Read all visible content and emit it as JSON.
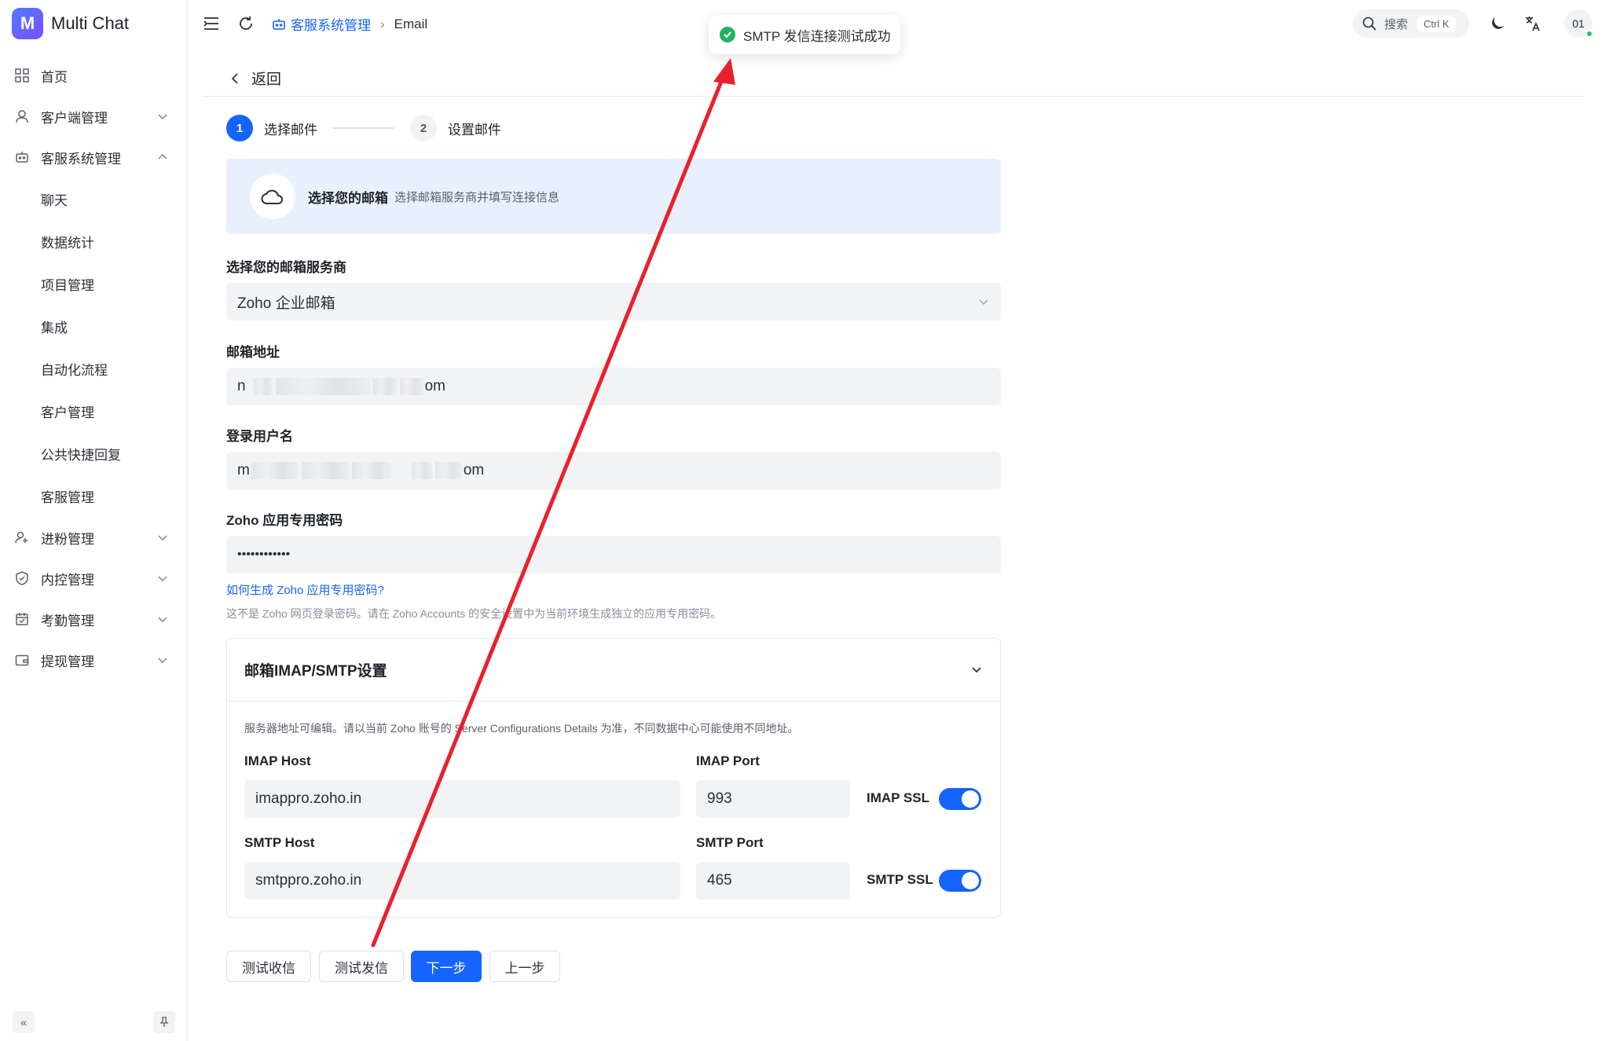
{
  "app": {
    "name": "Multi Chat",
    "logo_letter": "M"
  },
  "sidebar": {
    "items": [
      {
        "label": "首页",
        "icon": "grid-icon"
      },
      {
        "label": "客户端管理",
        "icon": "user-icon",
        "expandable": true
      },
      {
        "label": "客服系统管理",
        "icon": "robot-icon",
        "expandable": true,
        "expanded": true
      },
      {
        "label": "进粉管理",
        "icon": "user-plus-icon",
        "expandable": true
      },
      {
        "label": "内控管理",
        "icon": "shield-icon",
        "expandable": true
      },
      {
        "label": "考勤管理",
        "icon": "calendar-icon",
        "expandable": true
      },
      {
        "label": "提现管理",
        "icon": "wallet-icon",
        "expandable": true
      }
    ],
    "subitems": [
      "聊天",
      "数据统计",
      "项目管理",
      "集成",
      "自动化流程",
      "客户管理",
      "公共快捷回复",
      "客服管理"
    ]
  },
  "header": {
    "breadcrumb_parent": "客服系统管理",
    "breadcrumb_current": "Email",
    "search_label": "搜索",
    "search_shortcut": "Ctrl K",
    "avatar_text": "01"
  },
  "toast": {
    "message": "SMTP 发信连接测试成功",
    "status_color": "#22b35e"
  },
  "page": {
    "back_label": "返回",
    "steps": [
      {
        "num": "1",
        "label": "选择邮件"
      },
      {
        "num": "2",
        "label": "设置邮件"
      }
    ],
    "banner": {
      "title": "选择您的邮箱",
      "subtitle": "选择邮箱服务商并填写连接信息"
    },
    "provider": {
      "label": "选择您的邮箱服务商",
      "value": "Zoho 企业邮箱"
    },
    "email": {
      "label": "邮箱地址",
      "prefix": "n",
      "suffix": "om"
    },
    "username": {
      "label": "登录用户名",
      "prefix": "m",
      "suffix": "om"
    },
    "password": {
      "label": "Zoho 应用专用密码",
      "value": "••••••••••••"
    },
    "help_link": "如何生成 Zoho 应用专用密码?",
    "help_text": "这不是 Zoho 网页登录密码。请在 Zoho Accounts 的安全设置中为当前环境生成独立的应用专用密码。"
  },
  "imap_panel": {
    "title": "邮箱IMAP/SMTP设置",
    "note": "服务器地址可编辑。请以当前 Zoho 账号的 Server Configurations Details 为准，不同数据中心可能使用不同地址。",
    "imap_host_label": "IMAP Host",
    "imap_host": "imappro.zoho.in",
    "imap_port_label": "IMAP Port",
    "imap_port": "993",
    "imap_ssl_label": "IMAP SSL",
    "imap_ssl": true,
    "smtp_host_label": "SMTP Host",
    "smtp_host": "smtppro.zoho.in",
    "smtp_port_label": "SMTP Port",
    "smtp_port": "465",
    "smtp_ssl_label": "SMTP SSL",
    "smtp_ssl": true
  },
  "buttons": {
    "test_receive": "测试收信",
    "test_send": "测试发信",
    "next": "下一步",
    "prev": "上一步"
  },
  "colors": {
    "primary": "#1664ff",
    "banner_bg": "#e8f0fe",
    "arrow": "#e8212b"
  }
}
